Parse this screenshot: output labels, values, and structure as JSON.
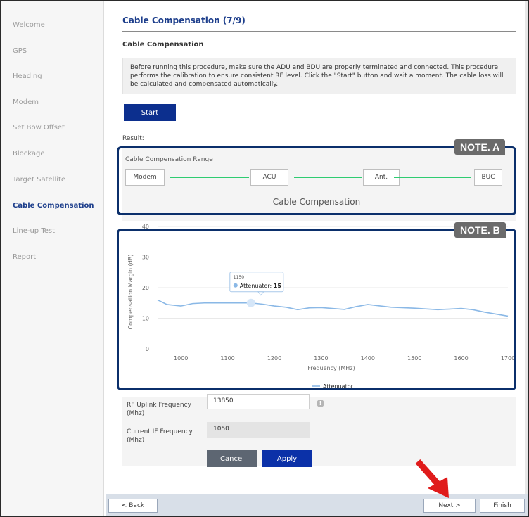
{
  "sidebar": {
    "items": [
      {
        "label": "Welcome",
        "active": false
      },
      {
        "label": "GPS",
        "active": false
      },
      {
        "label": "Heading",
        "active": false
      },
      {
        "label": "Modem",
        "active": false
      },
      {
        "label": "Set Bow Offset",
        "active": false
      },
      {
        "label": "Blockage",
        "active": false
      },
      {
        "label": "Target Satellite",
        "active": false
      },
      {
        "label": "Cable Compensation",
        "active": true
      },
      {
        "label": "Line-up Test",
        "active": false
      },
      {
        "label": "Report",
        "active": false
      }
    ]
  },
  "page": {
    "title": "Cable Compensation (7/9)",
    "section_title": "Cable Compensation",
    "info_text": "Before running this procedure, make sure the ADU and BDU are properly terminated and connected. This procedure performs the calibration to ensure consistent RF level. Click the \"Start\" button and wait a moment. The cable loss will be calculated and compensated automatically.",
    "start_label": "Start",
    "result_label": "Result:"
  },
  "range": {
    "title": "Cable Compensation Range",
    "nodes": [
      "Modem",
      "ACU",
      "Ant.",
      "BUC"
    ],
    "caption": "Cable Compensation"
  },
  "chart_data": {
    "type": "line",
    "xlabel": "Frequency (MHz)",
    "ylabel": "Compensation Margin (dB)",
    "xlim": [
      950,
      1700
    ],
    "ylim": [
      0,
      40
    ],
    "x_ticks": [
      1000,
      1100,
      1200,
      1300,
      1400,
      1500,
      1600,
      1700
    ],
    "y_ticks": [
      0,
      10,
      20,
      30,
      40
    ],
    "grid": true,
    "legend_position": "bottom",
    "series": [
      {
        "name": "Attenuator",
        "color": "#8ab8e6",
        "x": [
          950,
          970,
          1000,
          1025,
          1050,
          1100,
          1150,
          1175,
          1200,
          1225,
          1250,
          1275,
          1300,
          1350,
          1375,
          1400,
          1450,
          1500,
          1550,
          1600,
          1625,
          1650,
          1700
        ],
        "y": [
          16,
          14.5,
          14,
          14.8,
          15,
          15,
          15,
          14.6,
          14,
          13.6,
          12.8,
          13.4,
          13.5,
          12.9,
          13.8,
          14.5,
          13.6,
          13.3,
          12.8,
          13.2,
          12.8,
          12,
          10.7
        ]
      }
    ],
    "tooltip": {
      "x_label": "1150",
      "series": "Attenuator",
      "value": "15"
    }
  },
  "form": {
    "rf_uplink_label": "RF Uplink Frequency (Mhz)",
    "rf_uplink_value": "13850",
    "info_icon": "info-icon",
    "if_label": "Current IF Frequency (Mhz)",
    "if_value": "1050",
    "cancel_label": "Cancel",
    "apply_label": "Apply"
  },
  "footer": {
    "back_label": "< Back",
    "next_label": "Next >",
    "finish_label": "Finish"
  },
  "annotations": {
    "note_a": "NOTE. A",
    "note_b": "NOTE. B",
    "box_color": "#0b2f6b",
    "arrow_color": "#e01b1b"
  }
}
